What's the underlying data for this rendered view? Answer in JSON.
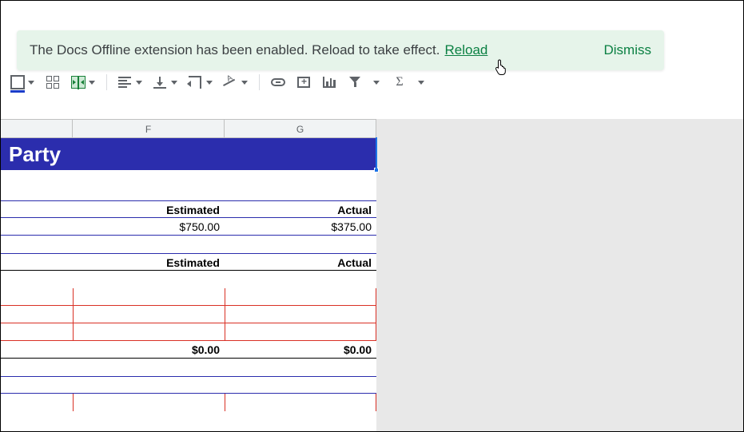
{
  "banner": {
    "message": "The Docs Offline extension has been enabled. Reload to take effect.",
    "reload": "Reload",
    "dismiss": "Dismiss"
  },
  "columns": {
    "f": "F",
    "g": "G"
  },
  "sheet": {
    "title": "Party",
    "hdr_est": "Estimated",
    "hdr_act": "Actual",
    "val_est": "$750.00",
    "val_act": "$375.00",
    "hdr2_est": "Estimated",
    "hdr2_act": "Actual",
    "tot_est": "$0.00",
    "tot_act": "$0.00"
  },
  "chart_data": {
    "type": "table",
    "title": "Party",
    "columns": [
      "Estimated",
      "Actual"
    ],
    "rows": [
      {
        "Estimated": 750.0,
        "Actual": 375.0
      }
    ],
    "subtable": {
      "columns": [
        "Estimated",
        "Actual"
      ],
      "rows": [
        {
          "Estimated": null,
          "Actual": null
        },
        {
          "Estimated": null,
          "Actual": null
        },
        {
          "Estimated": null,
          "Actual": null
        },
        {
          "Estimated": null,
          "Actual": null
        }
      ],
      "totals": {
        "Estimated": 0.0,
        "Actual": 0.0
      }
    },
    "currency": "USD"
  }
}
